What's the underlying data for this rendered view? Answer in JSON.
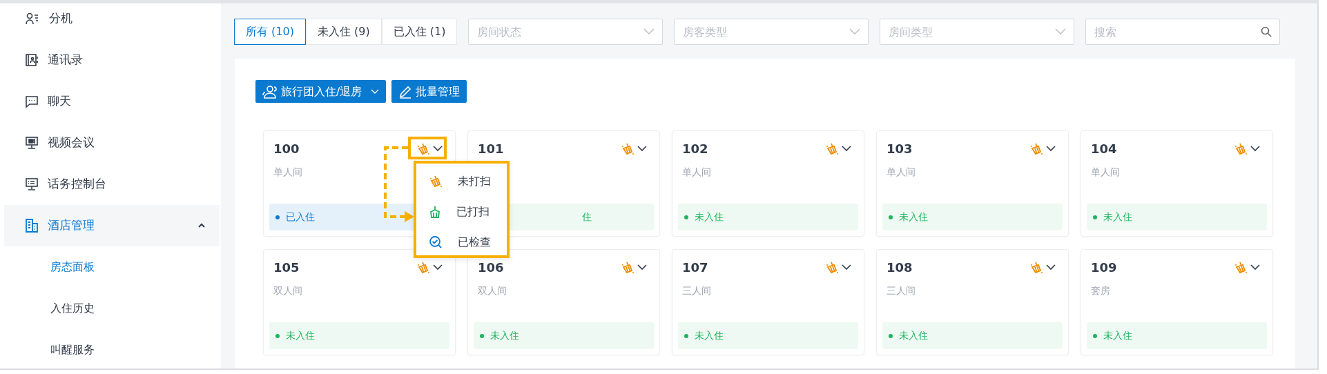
{
  "sidebar": {
    "items": [
      {
        "label": "分机",
        "selected": false
      },
      {
        "label": "通讯录",
        "selected": false
      },
      {
        "label": "聊天",
        "selected": false
      },
      {
        "label": "视频会议",
        "selected": false
      },
      {
        "label": "话务控制台",
        "selected": false
      },
      {
        "label": "酒店管理",
        "selected": true,
        "expanded": true,
        "children": [
          {
            "label": "房态面板",
            "selected": true
          },
          {
            "label": "入住历史",
            "selected": false
          },
          {
            "label": "叫醒服务",
            "selected": false
          }
        ]
      }
    ]
  },
  "tabs": [
    {
      "label": "所有 (10)",
      "selected": true
    },
    {
      "label": "未入住 (9)",
      "selected": false
    },
    {
      "label": "已入住 (1)",
      "selected": false
    }
  ],
  "filters": [
    {
      "placeholder": "房间状态"
    },
    {
      "placeholder": "房客类型"
    },
    {
      "placeholder": "房间类型"
    }
  ],
  "search": {
    "placeholder": "搜索"
  },
  "actions": [
    {
      "label": "旅行团入住/退房",
      "kind": "group",
      "dropdown": true
    },
    {
      "label": "批量管理",
      "kind": "edit",
      "dropdown": false
    }
  ],
  "rooms": [
    {
      "number": "100",
      "type": "单人间",
      "occupied": true,
      "status": "已入住",
      "cleaning": {
        "kind": "dirty"
      },
      "menu_open": true
    },
    {
      "number": "101",
      "occupied": false,
      "status": "住",
      "cleaning": {
        "kind": "dirty"
      },
      "covered_by_menu": true
    },
    {
      "number": "102",
      "type": "单人间",
      "occupied": false,
      "status": "未入住",
      "cleaning": {
        "kind": "dirty"
      }
    },
    {
      "number": "103",
      "type": "单人间",
      "occupied": false,
      "status": "未入住",
      "cleaning": {
        "kind": "dirty"
      }
    },
    {
      "number": "104",
      "type": "单人间",
      "occupied": false,
      "status": "未入住",
      "cleaning": {
        "kind": "dirty"
      }
    },
    {
      "number": "105",
      "type": "双人间",
      "occupied": false,
      "status": "未入住",
      "cleaning": {
        "kind": "dirty"
      }
    },
    {
      "number": "106",
      "type": "双人间",
      "occupied": false,
      "status": "未入住",
      "cleaning": {
        "kind": "dirty"
      }
    },
    {
      "number": "107",
      "type": "三人间",
      "occupied": false,
      "status": "未入住",
      "cleaning": {
        "kind": "dirty"
      }
    },
    {
      "number": "108",
      "type": "三人间",
      "occupied": false,
      "status": "未入住",
      "cleaning": {
        "kind": "dirty"
      }
    },
    {
      "number": "109",
      "type": "套房",
      "occupied": false,
      "status": "未入住",
      "cleaning": {
        "kind": "dirty"
      }
    }
  ],
  "cleaning_menu": {
    "items": [
      {
        "label": "未打扫",
        "kind": "dirty"
      },
      {
        "label": "已打扫",
        "kind": "cleaned"
      },
      {
        "label": "已检查",
        "kind": "inspected"
      }
    ]
  }
}
